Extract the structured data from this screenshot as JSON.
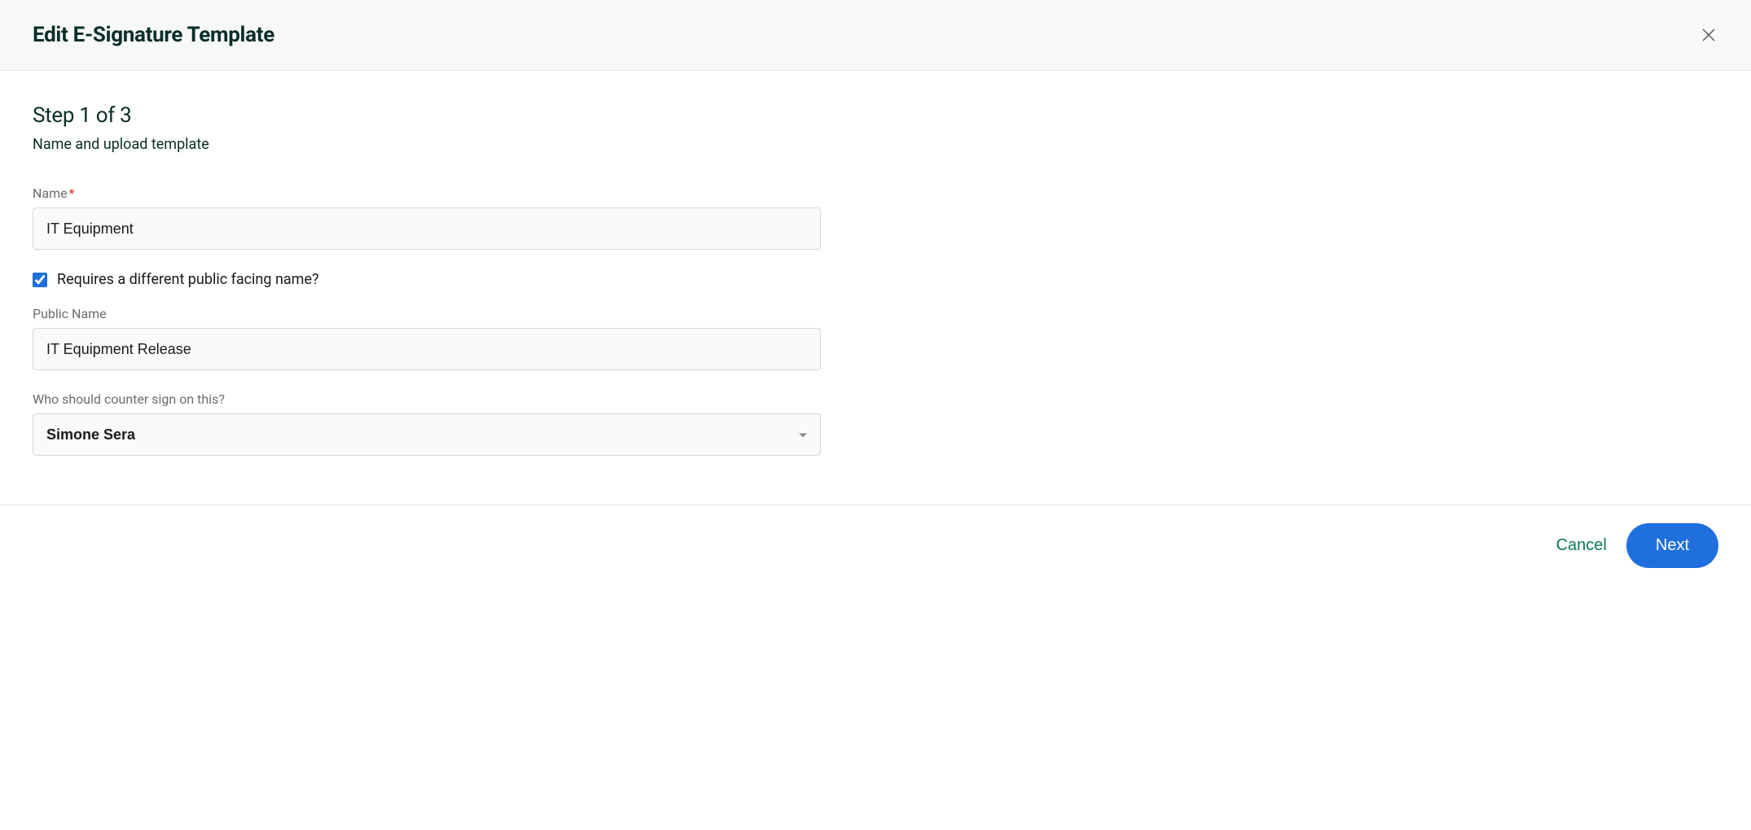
{
  "header": {
    "title": "Edit E-Signature Template"
  },
  "step": {
    "title": "Step 1 of 3",
    "subtitle": "Name and upload template"
  },
  "fields": {
    "name": {
      "label": "Name",
      "value": "IT Equipment"
    },
    "public_toggle": {
      "label": "Requires a different public facing name?",
      "checked": true
    },
    "public_name": {
      "label": "Public Name",
      "value": "IT Equipment Release"
    },
    "counter_sign": {
      "label": "Who should counter sign on this?",
      "selected": "Simone Sera"
    }
  },
  "footer": {
    "cancel_label": "Cancel",
    "next_label": "Next"
  }
}
